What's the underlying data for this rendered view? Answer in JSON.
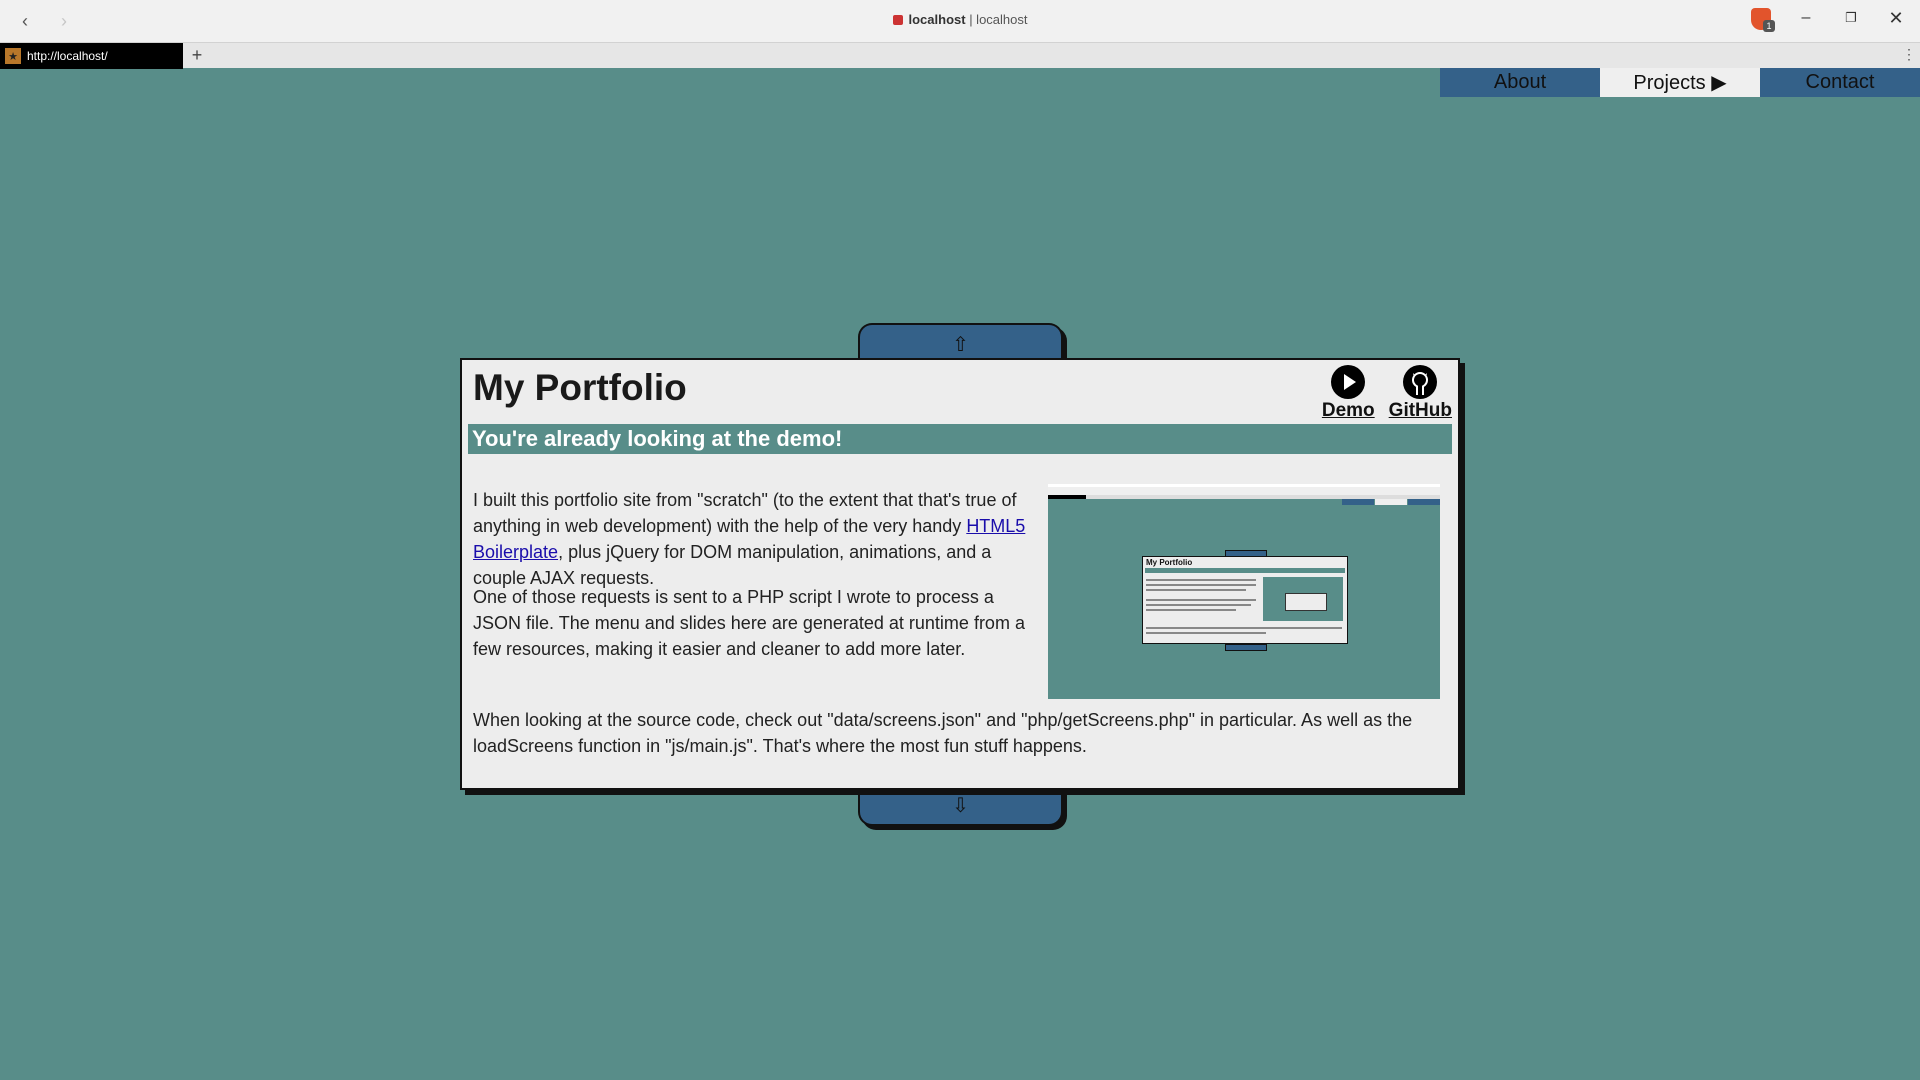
{
  "browser": {
    "host_bold": "localhost",
    "host_sep": " | localhost",
    "tab_url": "http://localhost/",
    "new_tab": "+",
    "back": "‹",
    "forward": "›",
    "badge": "1",
    "minimize": "–",
    "maximize": "❐",
    "close": "✕",
    "menu": "⋮"
  },
  "menu": {
    "items": [
      {
        "label": "About"
      },
      {
        "label": "Projects ▶"
      },
      {
        "label": "Contact"
      }
    ]
  },
  "slide": {
    "up_arrow": "⇧",
    "down_arrow": "⇩",
    "title": "My Portfolio",
    "demo_label": "Demo",
    "github_label": "GitHub",
    "banner": "You're already looking at the demo!",
    "p1_before": "I built this portfolio site from \"scratch\" (to the extent that that's true of anything in web development) with the help of the very handy ",
    "p1_link": "HTML5 Boilerplate",
    "p1_after": ", plus jQuery for DOM manipulation, animations, and a couple AJAX requests.",
    "p2": "One of those requests is sent to a PHP script I wrote to process a JSON file. The menu and slides here are generated at runtime from a few resources, making it easier and cleaner to add more later.",
    "p3": "When looking at the source code, check out \"data/screens.json\" and \"php/getScreens.php\" in particular. As well as the loadScreens function in \"js/main.js\". That's where the most fun stuff happens.",
    "thumb_title": "My Portfolio"
  },
  "colors": {
    "background": "#588d89",
    "menu": "#346189",
    "card": "#ededed"
  }
}
